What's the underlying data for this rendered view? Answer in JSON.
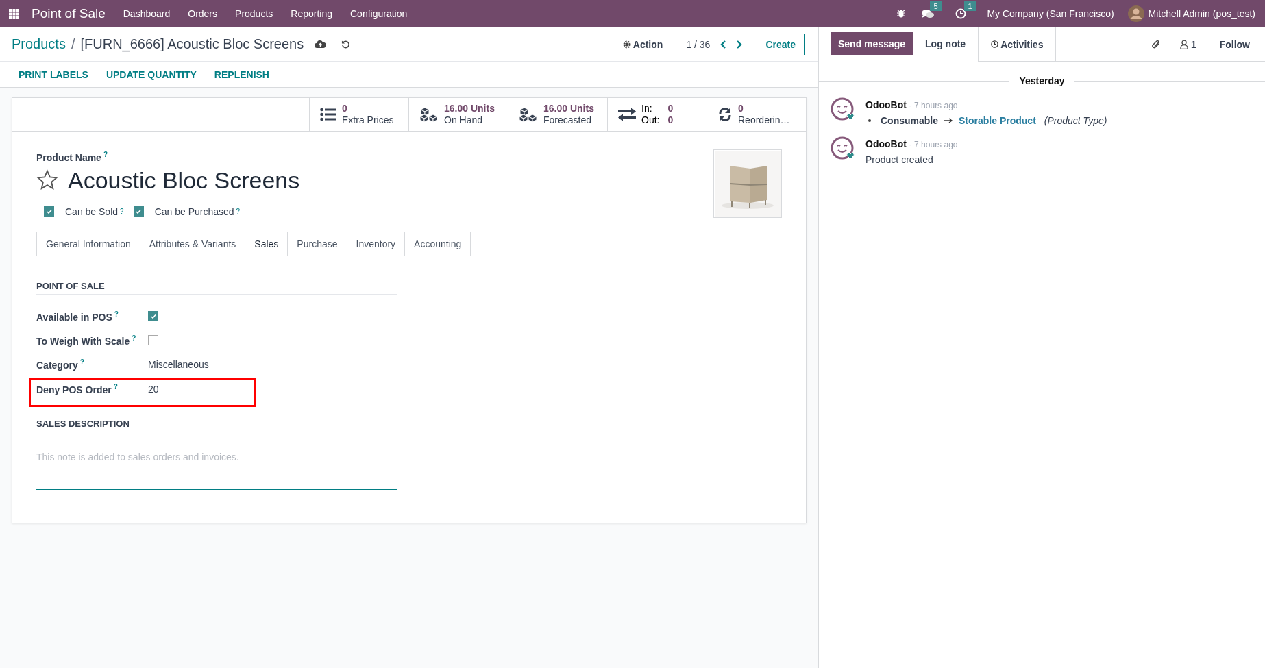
{
  "navbar": {
    "app_name": "Point of Sale",
    "menu": [
      "Dashboard",
      "Orders",
      "Products",
      "Reporting",
      "Configuration"
    ],
    "messages_badge": "5",
    "activities_badge": "1",
    "company": "My Company (San Francisco)",
    "user": "Mitchell Admin (pos_test)"
  },
  "breadcrumb": {
    "parent": "Products",
    "separator": "/",
    "current": "[FURN_6666] Acoustic Bloc Screens"
  },
  "action_label": "Action",
  "pager": "1 / 36",
  "create_label": "Create",
  "header_buttons": [
    "PRINT LABELS",
    "UPDATE QUANTITY",
    "REPLENISH"
  ],
  "smart_buttons": [
    {
      "kind": "list",
      "value": "0",
      "label": "Extra Prices"
    },
    {
      "kind": "cubes",
      "value": "16.00 Units",
      "label": "On Hand"
    },
    {
      "kind": "cubes",
      "value": "16.00 Units",
      "label": "Forecasted"
    },
    {
      "kind": "inout",
      "in_label": "In:",
      "in_value": "0",
      "out_label": "Out:",
      "out_value": "0"
    },
    {
      "kind": "refresh",
      "value": "0",
      "label": "Reorderin…"
    }
  ],
  "product": {
    "name_label": "Product Name",
    "help": "?",
    "name": "Acoustic Bloc Screens",
    "favorite": false
  },
  "options": [
    {
      "label": "Can be Sold",
      "help": "?",
      "checked": true
    },
    {
      "label": "Can be Purchased",
      "help": "?",
      "checked": true
    }
  ],
  "tabs": [
    {
      "label": "General Information",
      "selected": false
    },
    {
      "label": "Attributes & Variants",
      "selected": false
    },
    {
      "label": "Sales",
      "selected": true
    },
    {
      "label": "Purchase",
      "selected": false
    },
    {
      "label": "Inventory",
      "selected": false
    },
    {
      "label": "Accounting",
      "selected": false
    }
  ],
  "pos_section": {
    "title": "POINT OF SALE",
    "fields": [
      {
        "kind": "checkbox",
        "label": "Available in POS",
        "help": "?",
        "checked": true,
        "highlighted": false
      },
      {
        "kind": "checkbox",
        "label": "To Weigh With Scale",
        "help": "?",
        "checked": false,
        "highlighted": false
      },
      {
        "kind": "text",
        "label": "Category",
        "help": "?",
        "value": "Miscellaneous",
        "highlighted": false
      },
      {
        "kind": "text",
        "label": "Deny POS Order",
        "help": "?",
        "value": "20",
        "highlighted": true
      }
    ]
  },
  "sales_description": {
    "title": "SALES DESCRIPTION",
    "placeholder": "This note is added to sales orders and invoices."
  },
  "chatter": {
    "send_label": "Send message",
    "log_label": "Log note",
    "activities_label": "Activities",
    "followers": "1",
    "follow_label": "Follow",
    "date_separator": "Yesterday",
    "messages": [
      {
        "kind": "tracking",
        "author": "OdooBot",
        "time": "- 7 hours ago",
        "old": "Consumable",
        "new": "Storable Product",
        "field": "(Product Type)"
      },
      {
        "kind": "text",
        "author": "OdooBot",
        "time": "- 7 hours ago",
        "body": "Product created"
      }
    ]
  }
}
